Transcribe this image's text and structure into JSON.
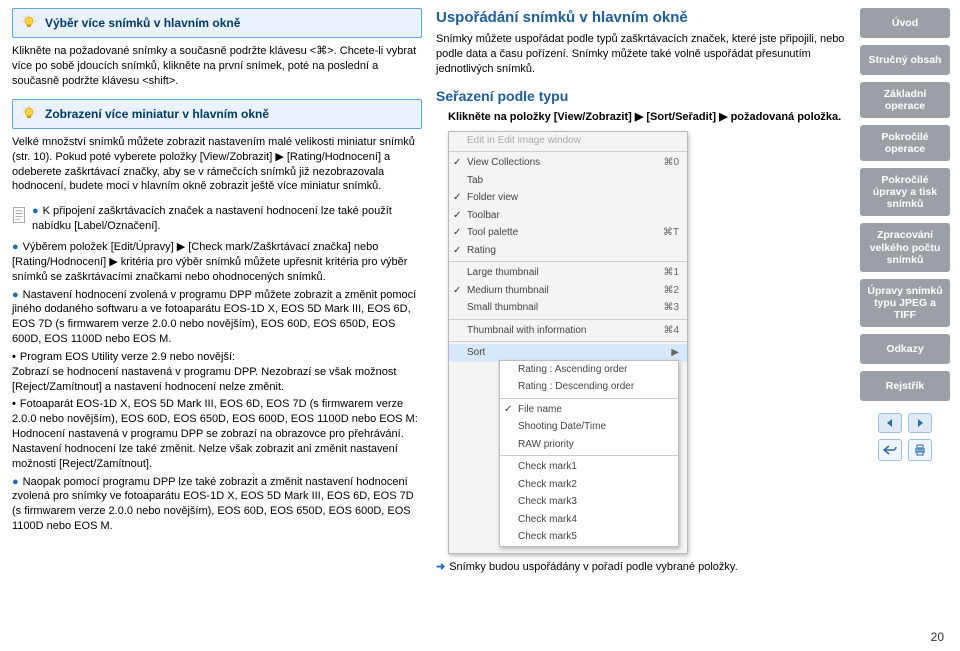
{
  "left": {
    "tip1_title": "Výběr více snímků v hlavním okně",
    "tip1_body": "Klikněte na požadované snímky a současně podržte klávesu <⌘>. Chcete-li vybrat více po sobě jdoucích snímků, klikněte na první snímek, poté na poslední a současně podržte klávesu <shift>.",
    "tip2_title": "Zobrazení více miniatur v hlavním okně",
    "tip2_body": "Velké množství snímků můžete zobrazit nastavením malé velikosti miniatur snímků (str. 10). Pokud poté vyberete položky [View/Zobrazit] ▶ [Rating/Hodnocení] a odeberete zaškrtávací značky, aby se v rámečcích snímků již nezobrazovala hodnocení, budete moci v hlavním okně zobrazit ještě více miniatur snímků.",
    "attach_intro": "K připojení zaškrtávacích značek a nastavení hodnocení lze také použít nabídku [Label/Označení].",
    "bullets": [
      "Výběrem položek [Edit/Úpravy] ▶ [Check mark/Zaškrtávací značka] nebo [Rating/Hodnocení] ▶ kritéria pro výběr snímků můžete upřesnit kritéria pro výběr snímků se zaškrtávacími značkami nebo ohodnocených snímků.",
      "Nastavení hodnocení zvolená v programu DPP můžete zobrazit a změnit pomocí jiného dodaného softwaru a ve fotoaparátu EOS-1D X, EOS 5D Mark III, EOS 6D, EOS 7D (s firmwarem verze 2.0.0 nebo novějším), EOS 60D, EOS 650D, EOS 600D, EOS 1100D nebo EOS M."
    ],
    "sub": [
      {
        "head": "Program EOS Utility verze 2.9 nebo novější:",
        "body": "Zobrazí se hodnocení nastavená v programu DPP. Nezobrazí se však možnost [Reject/Zamítnout] a nastavení hodnocení nelze změnit."
      },
      {
        "head": "Fotoaparát EOS-1D X, EOS 5D Mark III, EOS 6D, EOS 7D (s firmwarem verze 2.0.0 nebo novějším), EOS 60D, EOS 650D, EOS 600D, EOS 1100D nebo EOS M:",
        "body": "Hodnocení nastavená v programu DPP se zobrazí na obrazovce pro přehrávání. Nastavení hodnocení lze také změnit. Nelze však zobrazit ani změnit nastavení možnosti [Reject/Zamítnout]."
      }
    ],
    "bullet3": "Naopak pomocí programu DPP lze také zobrazit a změnit nastavení hodnocení zvolená pro snímky ve fotoaparátu EOS-1D X, EOS 5D Mark III, EOS 6D, EOS 7D (s firmwarem verze 2.0.0 nebo novějším), EOS 60D, EOS 650D, EOS 600D, EOS 1100D nebo EOS M."
  },
  "mid": {
    "h2": "Uspořádání snímků v hlavním okně",
    "intro": "Snímky můžete uspořádat podle typů zaškrtávacích značek, které jste připojili, nebo podle data a času pořízení. Snímky můžete také volně uspořádat přesunutím jednotlivých snímků.",
    "h3": "Seřazení podle typu",
    "step": "Klikněte na položky [View/Zobrazit] ▶ [Sort/Seřadit] ▶ požadovaná položka.",
    "menu": {
      "top_dim": "Edit in Edit image window",
      "sec1": [
        "View Collections",
        "Tab",
        "Folder view",
        "Toolbar",
        "Tool palette",
        "Rating"
      ],
      "sec1_checks": [
        true,
        false,
        true,
        true,
        true,
        true
      ],
      "sec1_short": [
        "⌘0",
        "",
        "",
        "",
        "⌘T",
        ""
      ],
      "sec2": [
        "Large thumbnail",
        "Medium thumbnail",
        "Small thumbnail"
      ],
      "sec2_checks": [
        false,
        true,
        false
      ],
      "sec2_short": [
        "⌘1",
        "⌘2",
        "⌘3"
      ],
      "thumbinfo": "Thumbnail with information",
      "thumbinfo_short": "⌘4",
      "sort_label": "Sort",
      "sub_top": [
        "Rating : Ascending order",
        "Rating : Descending order"
      ],
      "sub_sec2": [
        "File name",
        "Shooting Date/Time",
        "RAW priority"
      ],
      "sub_sec3": [
        "Check mark1",
        "Check mark2",
        "Check mark3",
        "Check mark4",
        "Check mark5"
      ],
      "sub_sec2_chk": [
        true,
        false,
        false
      ]
    },
    "result": "Snímky budou uspořádány v pořadí podle vybrané položky."
  },
  "side": {
    "items": [
      "Úvod",
      "Stručný obsah",
      "Základní operace",
      "Pokročilé operace",
      "Pokročilé úpravy a tisk snímků",
      "Zpracování velkého počtu snímků",
      "Úpravy snímků typu JPEG a TIFF",
      "Odkazy",
      "Rejstřík"
    ],
    "page": "20"
  }
}
